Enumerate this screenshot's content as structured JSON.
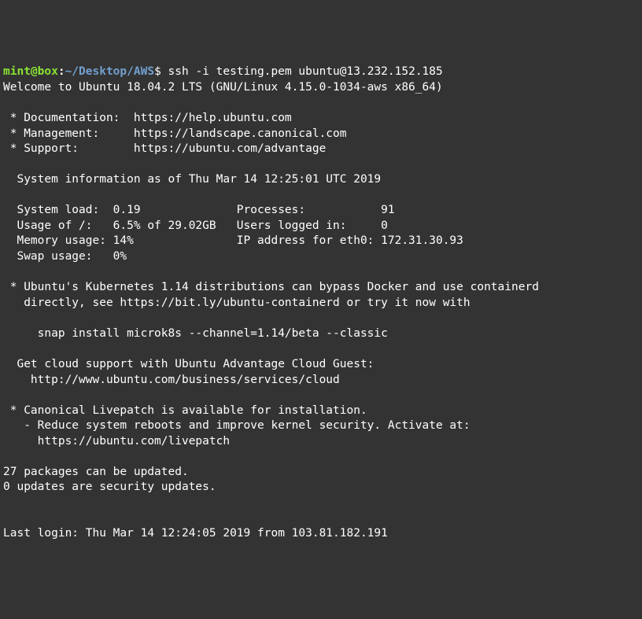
{
  "prompt": {
    "user": "mint@box",
    "colon1": ":",
    "path": "~/Desktop/AWS",
    "dollar": "$ ",
    "command": "ssh -i testing.pem ubuntu@13.232.152.185"
  },
  "welcome": "Welcome to Ubuntu 18.04.2 LTS (GNU/Linux 4.15.0-1034-aws x86_64)",
  "docs": {
    "doc_label": " * Documentation:  ",
    "doc_url": "https://help.ubuntu.com",
    "mgmt_label": " * Management:     ",
    "mgmt_url": "https://landscape.canonical.com",
    "support_label": " * Support:        ",
    "support_url": "https://ubuntu.com/advantage"
  },
  "sysinfo_header": "  System information as of Thu Mar 14 12:25:01 UTC 2019",
  "sysinfo": {
    "line1": "  System load:  0.19              Processes:           91",
    "line2": "  Usage of /:   6.5% of 29.02GB   Users logged in:     0",
    "line3": "  Memory usage: 14%               IP address for eth0: 172.31.30.93",
    "line4": "  Swap usage:   0%"
  },
  "k8s": {
    "line1": " * Ubuntu's Kubernetes 1.14 distributions can bypass Docker and use containerd",
    "line2": "   directly, see https://bit.ly/ubuntu-containerd or try it now with",
    "snap": "     snap install microk8s --channel=1.14/beta --classic"
  },
  "cloud": {
    "line1": "  Get cloud support with Ubuntu Advantage Cloud Guest:",
    "line2": "    http://www.ubuntu.com/business/services/cloud"
  },
  "livepatch": {
    "line1": " * Canonical Livepatch is available for installation.",
    "line2": "   - Reduce system reboots and improve kernel security. Activate at:",
    "line3": "     https://ubuntu.com/livepatch"
  },
  "updates": {
    "line1": "27 packages can be updated.",
    "line2": "0 updates are security updates."
  },
  "lastlogin": "Last login: Thu Mar 14 12:24:05 2019 from 103.81.182.191"
}
